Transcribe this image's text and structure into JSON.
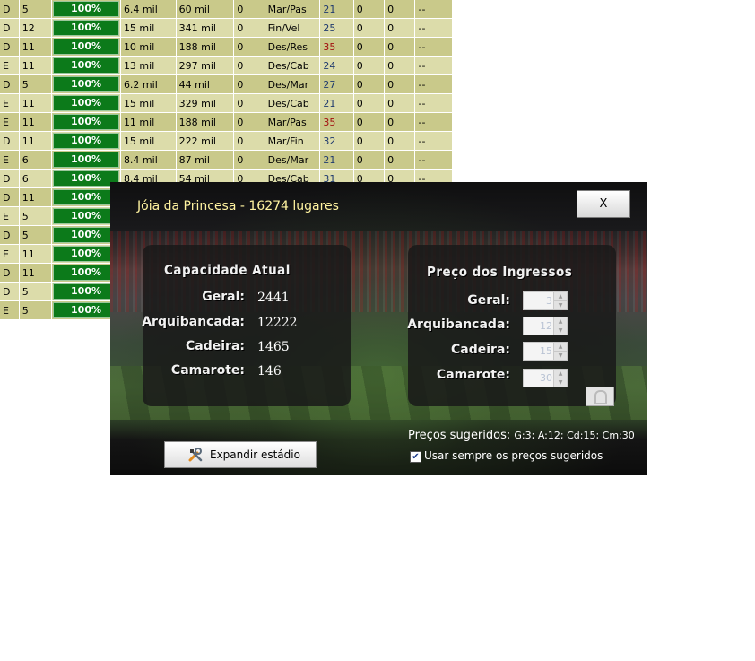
{
  "table": {
    "rows": [
      [
        "D",
        "5",
        "100%",
        "6.4 mil",
        "60 mil",
        "0",
        "Mar/Pas",
        "21",
        "0",
        "0",
        "--"
      ],
      [
        "D",
        "12",
        "100%",
        "15 mil",
        "341 mil",
        "0",
        "Fin/Vel",
        "25",
        "0",
        "0",
        "--"
      ],
      [
        "D",
        "11",
        "100%",
        "10 mil",
        "188 mil",
        "0",
        "Des/Res",
        "35",
        "0",
        "0",
        "--"
      ],
      [
        "E",
        "11",
        "100%",
        "13 mil",
        "297 mil",
        "0",
        "Des/Cab",
        "24",
        "0",
        "0",
        "--"
      ],
      [
        "D",
        "5",
        "100%",
        "6.2 mil",
        "44 mil",
        "0",
        "Des/Mar",
        "27",
        "0",
        "0",
        "--"
      ],
      [
        "E",
        "11",
        "100%",
        "15 mil",
        "329 mil",
        "0",
        "Des/Cab",
        "21",
        "0",
        "0",
        "--"
      ],
      [
        "E",
        "11",
        "100%",
        "11 mil",
        "188 mil",
        "0",
        "Mar/Pas",
        "35",
        "0",
        "0",
        "--"
      ],
      [
        "D",
        "11",
        "100%",
        "15 mil",
        "222 mil",
        "0",
        "Mar/Fin",
        "32",
        "0",
        "0",
        "--"
      ],
      [
        "E",
        "6",
        "100%",
        "8.4 mil",
        "87 mil",
        "0",
        "Des/Mar",
        "21",
        "0",
        "0",
        "--"
      ],
      [
        "D",
        "6",
        "100%",
        "8.4 mil",
        "54 mil",
        "0",
        "Des/Cab",
        "31",
        "0",
        "0",
        "--"
      ],
      [
        "D",
        "11",
        "100%",
        "",
        "",
        "",
        "",
        "",
        "",
        "",
        ""
      ],
      [
        "E",
        "5",
        "100%",
        "",
        "",
        "",
        "",
        "",
        "",
        "",
        ""
      ],
      [
        "D",
        "5",
        "100%",
        "",
        "",
        "",
        "",
        "",
        "",
        "",
        ""
      ],
      [
        "E",
        "11",
        "100%",
        "",
        "",
        "",
        "",
        "",
        "",
        "",
        ""
      ],
      [
        "D",
        "11",
        "100%",
        "",
        "",
        "",
        "",
        "",
        "",
        "",
        ""
      ],
      [
        "D",
        "5",
        "100%",
        "",
        "",
        "",
        "",
        "",
        "",
        "",
        ""
      ],
      [
        "E",
        "5",
        "100%",
        "",
        "",
        "",
        "",
        "",
        "",
        "",
        ""
      ]
    ],
    "red_values": [
      "35"
    ]
  },
  "dialog": {
    "title": "Jóia da Princesa - 16274 lugares",
    "close_label": "X",
    "capacity": {
      "title": "Capacidade Atual",
      "rows": [
        {
          "label": "Geral:",
          "value": "2441"
        },
        {
          "label": "Arquibancada:",
          "value": "12222"
        },
        {
          "label": "Cadeira:",
          "value": "1465"
        },
        {
          "label": "Camarote:",
          "value": "146"
        }
      ]
    },
    "prices": {
      "title": "Preço dos Ingressos",
      "rows": [
        {
          "label": "Geral:",
          "value": "3"
        },
        {
          "label": "Arquibancada:",
          "value": "12"
        },
        {
          "label": "Cadeira:",
          "value": "15"
        },
        {
          "label": "Camarote:",
          "value": "30"
        }
      ]
    },
    "expand_label": "Expandir estádio",
    "suggested_label": "Preços sugeridos:",
    "suggested_values": "G:3; A:12; Cd:15; Cm:30",
    "auto_label": "Usar sempre os preços sugeridos",
    "auto_checked": true,
    "colors": {
      "title": "#fff3a0",
      "pct_bg": "#0c7a1a"
    }
  }
}
